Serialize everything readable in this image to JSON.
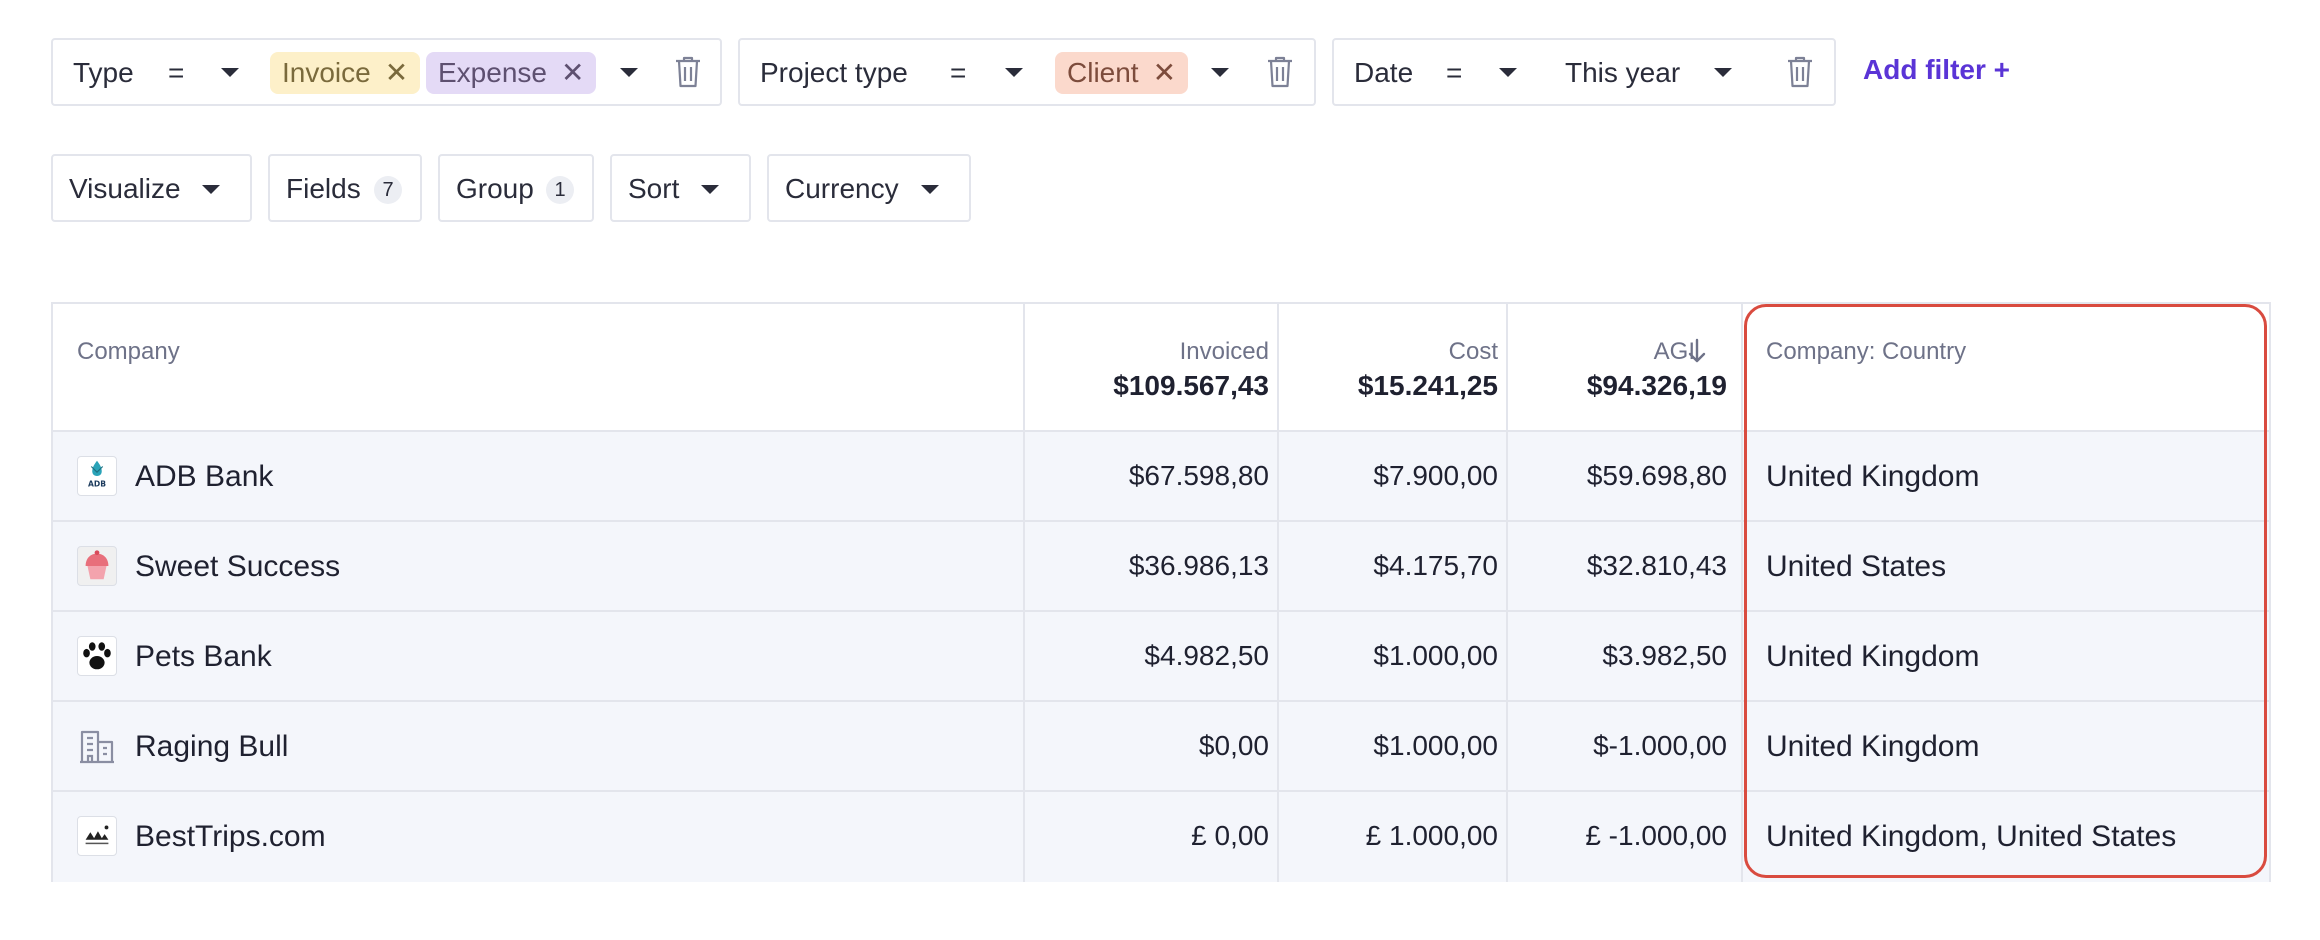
{
  "filters": {
    "type": {
      "label": "Type",
      "operator": "=",
      "chips": [
        "Invoice",
        "Expense"
      ]
    },
    "project_type": {
      "label": "Project type",
      "operator": "=",
      "chips": [
        "Client"
      ]
    },
    "date": {
      "label": "Date",
      "operator": "=",
      "value": "This year"
    },
    "add_filter": "Add filter +"
  },
  "toolbar": {
    "visualize": "Visualize",
    "fields": "Fields",
    "fields_count": "7",
    "group": "Group",
    "group_count": "1",
    "sort": "Sort",
    "currency": "Currency"
  },
  "table": {
    "headers": {
      "company": "Company",
      "invoiced": "Invoiced",
      "invoiced_total": "$109.567,43",
      "cost": "Cost",
      "cost_total": "$15.241,25",
      "agi": "AGI",
      "agi_total": "$94.326,19",
      "country": "Company: Country"
    },
    "rows": [
      {
        "company": "ADB Bank",
        "invoiced": "$67.598,80",
        "cost": "$7.900,00",
        "agi": "$59.698,80",
        "country": "United Kingdom",
        "logo": "adb-bank-logo",
        "logo_text": "ADB"
      },
      {
        "company": "Sweet Success",
        "invoiced": "$36.986,13",
        "cost": "$4.175,70",
        "agi": "$32.810,43",
        "country": "United States",
        "logo": "cupcake-logo"
      },
      {
        "company": "Pets Bank",
        "invoiced": "$4.982,50",
        "cost": "$1.000,00",
        "agi": "$3.982,50",
        "country": "United Kingdom",
        "logo": "paw-logo"
      },
      {
        "company": "Raging Bull",
        "invoiced": "$0,00",
        "cost": "$1.000,00",
        "agi": "$-1.000,00",
        "country": "United Kingdom",
        "logo": "building-icon"
      },
      {
        "company": "BestTrips.com",
        "invoiced": "£ 0,00",
        "cost": "£ 1.000,00",
        "agi": "£ -1.000,00",
        "country": "United Kingdom, United States",
        "logo": "besttrips-logo"
      }
    ]
  },
  "colors": {
    "accent": "#5a34d6",
    "highlight": "#d94b3f",
    "chip_invoice": "#fdf0c9",
    "chip_expense": "#e4daf6",
    "chip_client": "#fbd9cc",
    "row_bg": "#f4f6fb"
  }
}
